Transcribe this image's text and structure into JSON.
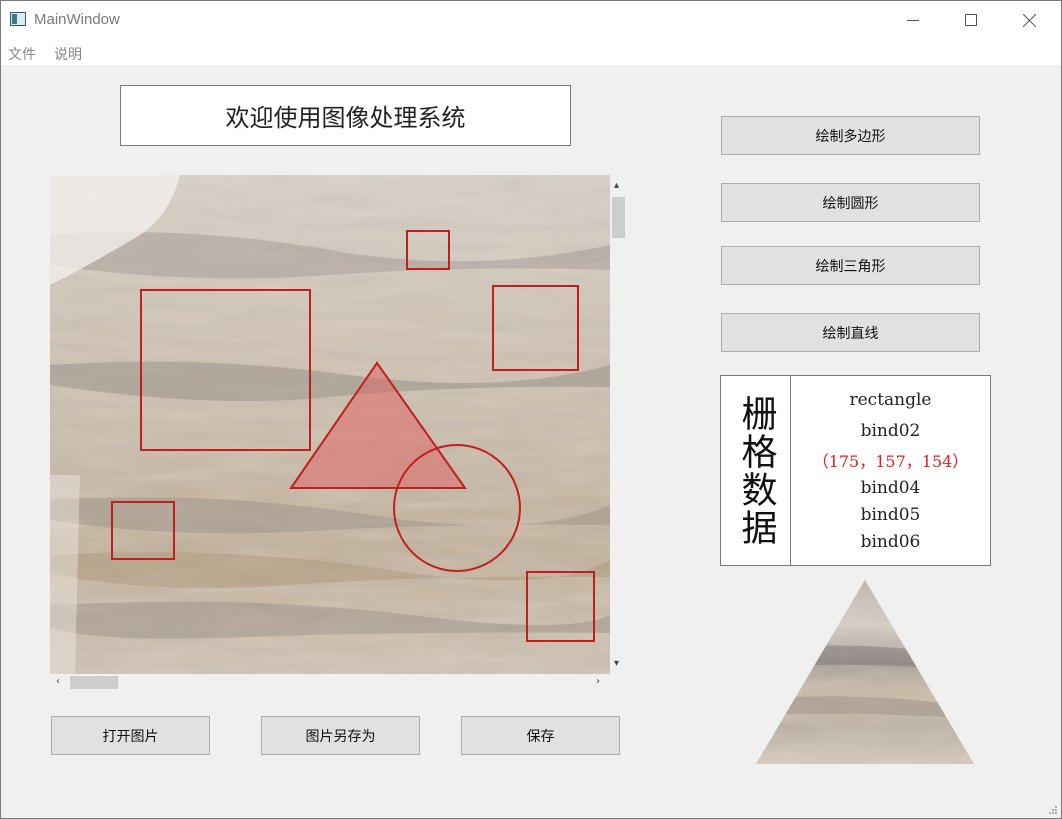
{
  "window": {
    "title": "MainWindow",
    "controls": {
      "minimize": "minimize",
      "maximize": "maximize",
      "close": "close"
    }
  },
  "menubar": {
    "items": [
      {
        "label": "文件"
      },
      {
        "label": "说明"
      }
    ]
  },
  "headline": "欢迎使用图像处理系统",
  "canvas": {
    "shapes": [
      {
        "type": "rectangle"
      },
      {
        "type": "rectangle"
      },
      {
        "type": "rectangle"
      },
      {
        "type": "rectangle"
      },
      {
        "type": "rectangle"
      },
      {
        "type": "triangle",
        "fill": "#e06060"
      },
      {
        "type": "circle"
      }
    ],
    "stroke_color": "#c0201c"
  },
  "bottom_buttons": {
    "open": "打开图片",
    "save_as": "图片另存为",
    "save": "保存"
  },
  "side_buttons": {
    "polygon": "绘制多边形",
    "circle": "绘制圆形",
    "triangle": "绘制三角形",
    "line": "绘制直线"
  },
  "grid": {
    "title": "栅格数据",
    "lines": [
      "rectangle",
      "bind02",
      "（175，157，154）",
      "bind04",
      "bind05",
      "bind06"
    ],
    "highlight_color": "#e01e1e"
  },
  "preview": {
    "shape": "triangle"
  },
  "colors": {
    "accent_red": "#c0201c",
    "window_bg": "#f0f0f0",
    "button_bg": "#e1e1e1"
  }
}
